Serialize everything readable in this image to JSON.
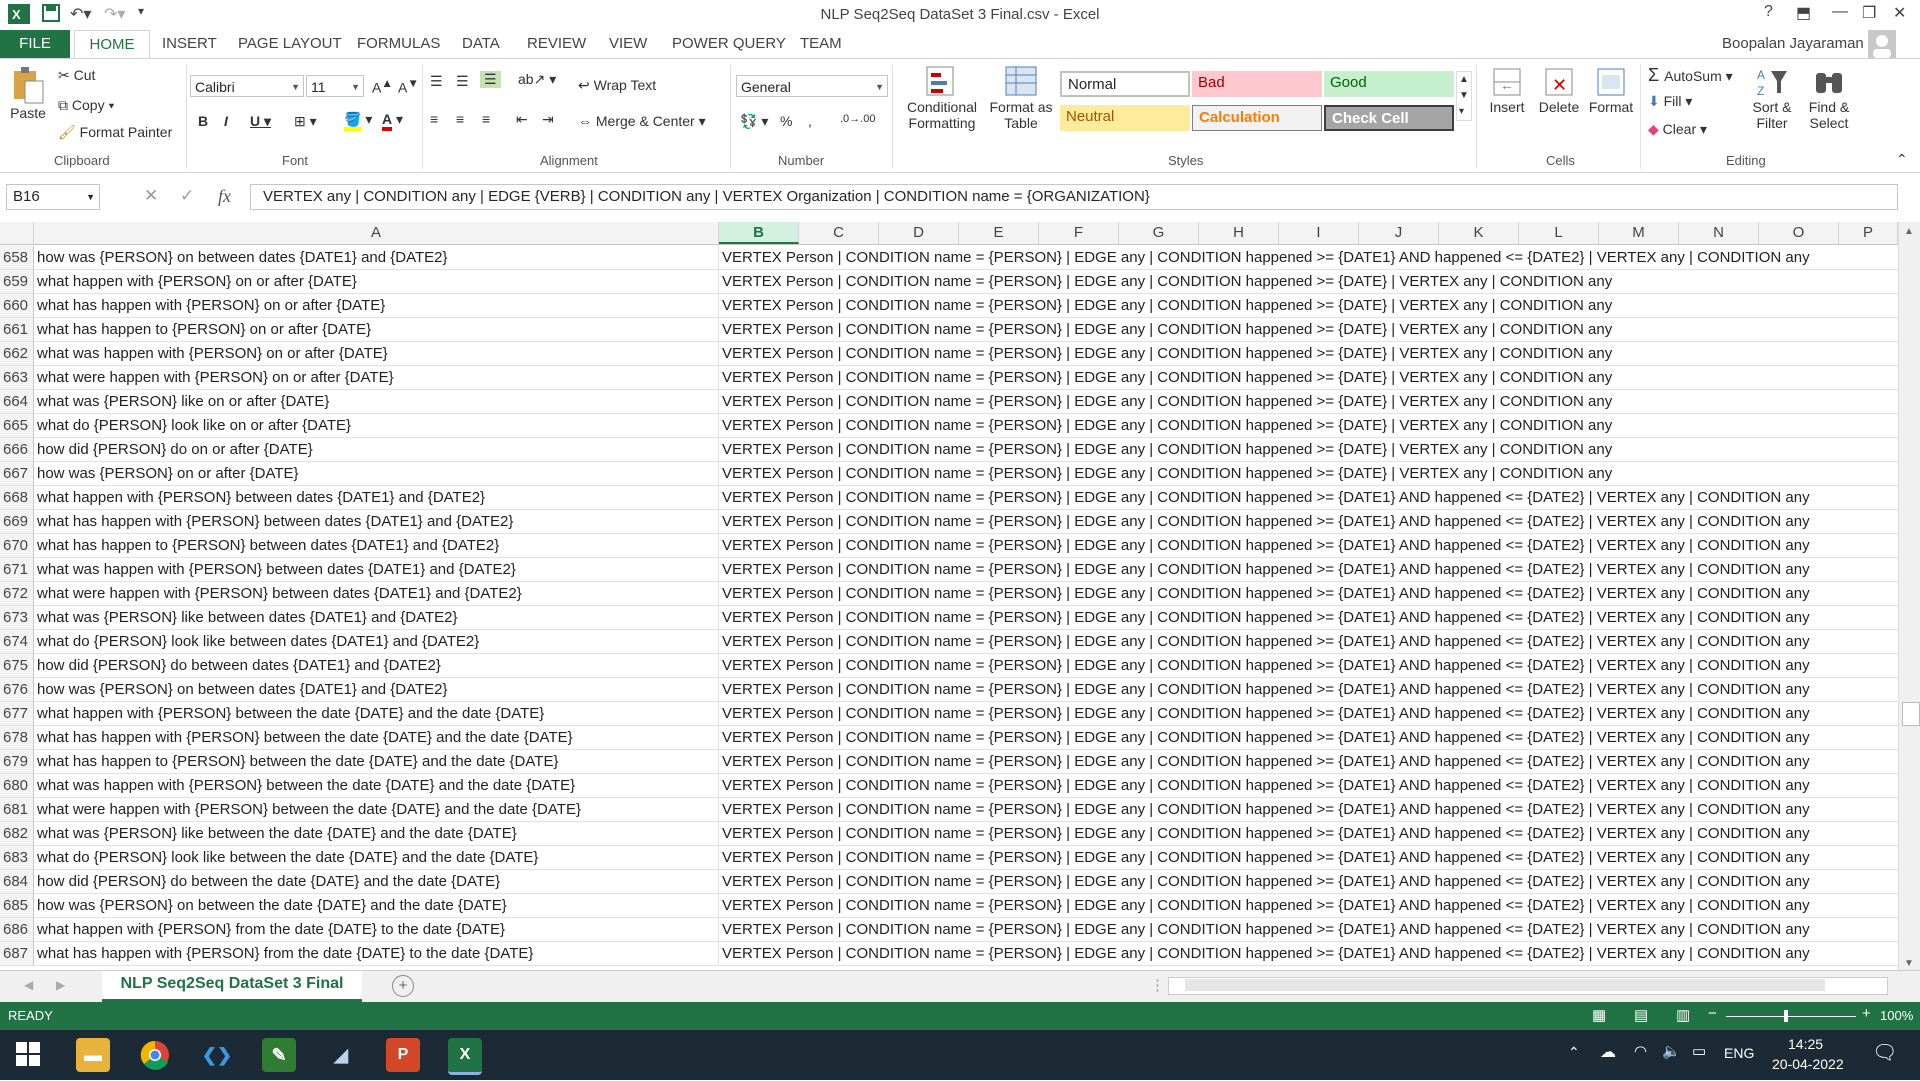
{
  "window": {
    "title": "NLP Seq2Seq DataSet 3 Final.csv - Excel",
    "user": "Boopalan Jayaraman"
  },
  "tabs": [
    "FILE",
    "HOME",
    "INSERT",
    "PAGE LAYOUT",
    "FORMULAS",
    "DATA",
    "REVIEW",
    "VIEW",
    "POWER QUERY",
    "TEAM"
  ],
  "ribbon": {
    "clipboard": {
      "label": "Clipboard",
      "paste": "Paste",
      "cut": "Cut",
      "copy": "Copy",
      "format_painter": "Format Painter"
    },
    "font": {
      "label": "Font",
      "name": "Calibri",
      "size": "11"
    },
    "alignment": {
      "label": "Alignment",
      "wrap": "Wrap Text",
      "merge": "Merge & Center"
    },
    "number": {
      "label": "Number",
      "format": "General"
    },
    "styles": {
      "label": "Styles",
      "conditional1": "Conditional",
      "conditional2": "Formatting",
      "table1": "Format as",
      "table2": "Table",
      "normal": "Normal",
      "bad": "Bad",
      "good": "Good",
      "neutral": "Neutral",
      "calculation": "Calculation",
      "check": "Check Cell"
    },
    "cells": {
      "label": "Cells",
      "insert": "Insert",
      "delete": "Delete",
      "format": "Format"
    },
    "editing": {
      "label": "Editing",
      "autosum": "AutoSum",
      "fill": "Fill",
      "clear": "Clear",
      "sort1": "Sort &",
      "sort2": "Filter",
      "find1": "Find &",
      "find2": "Select"
    }
  },
  "formula_bar": {
    "name_box": "B16",
    "fx": "fx",
    "formula": "VERTEX any | CONDITION any | EDGE {VERB} | CONDITION any | VERTEX Organization | CONDITION name = {ORGANIZATION}"
  },
  "columns": [
    "A",
    "B",
    "C",
    "D",
    "E",
    "F",
    "G",
    "H",
    "I",
    "J",
    "K",
    "L",
    "M",
    "N",
    "O",
    "P"
  ],
  "rows": [
    {
      "n": "658",
      "a": "how was {PERSON} on between dates {DATE1} and {DATE2}",
      "b": "VERTEX Person | CONDITION name = {PERSON} | EDGE any | CONDITION happened >= {DATE1} AND happened <= {DATE2} | VERTEX any | CONDITION any"
    },
    {
      "n": "659",
      "a": "what happen with {PERSON} on or after {DATE}",
      "b": "VERTEX Person | CONDITION name = {PERSON} | EDGE any | CONDITION happened >= {DATE} | VERTEX any | CONDITION any"
    },
    {
      "n": "660",
      "a": "what has happen with {PERSON} on or after {DATE}",
      "b": "VERTEX Person | CONDITION name = {PERSON} | EDGE any | CONDITION happened >= {DATE} | VERTEX any | CONDITION any"
    },
    {
      "n": "661",
      "a": "what has happen to {PERSON} on or after {DATE}",
      "b": "VERTEX Person | CONDITION name = {PERSON} | EDGE any | CONDITION happened >= {DATE} | VERTEX any | CONDITION any"
    },
    {
      "n": "662",
      "a": "what was happen with {PERSON} on or after {DATE}",
      "b": "VERTEX Person | CONDITION name = {PERSON} | EDGE any | CONDITION happened >= {DATE} | VERTEX any | CONDITION any"
    },
    {
      "n": "663",
      "a": "what were happen with {PERSON} on or after {DATE}",
      "b": "VERTEX Person | CONDITION name = {PERSON} | EDGE any | CONDITION happened >= {DATE} | VERTEX any | CONDITION any"
    },
    {
      "n": "664",
      "a": "what was {PERSON} like on or after {DATE}",
      "b": "VERTEX Person | CONDITION name = {PERSON} | EDGE any | CONDITION happened >= {DATE} | VERTEX any | CONDITION any"
    },
    {
      "n": "665",
      "a": "what do {PERSON} look like on or after {DATE}",
      "b": "VERTEX Person | CONDITION name = {PERSON} | EDGE any | CONDITION happened >= {DATE} | VERTEX any | CONDITION any"
    },
    {
      "n": "666",
      "a": "how did {PERSON} do on or after {DATE}",
      "b": "VERTEX Person | CONDITION name = {PERSON} | EDGE any | CONDITION happened >= {DATE} | VERTEX any | CONDITION any"
    },
    {
      "n": "667",
      "a": "how was {PERSON} on or after {DATE}",
      "b": "VERTEX Person | CONDITION name = {PERSON} | EDGE any | CONDITION happened >= {DATE} | VERTEX any | CONDITION any"
    },
    {
      "n": "668",
      "a": "what happen with {PERSON} between dates {DATE1} and {DATE2}",
      "b": "VERTEX Person | CONDITION name = {PERSON} | EDGE any | CONDITION happened >= {DATE1} AND happened <= {DATE2} | VERTEX any | CONDITION any"
    },
    {
      "n": "669",
      "a": "what has happen with {PERSON} between dates {DATE1} and {DATE2}",
      "b": "VERTEX Person | CONDITION name = {PERSON} | EDGE any | CONDITION happened >= {DATE1} AND happened <= {DATE2} | VERTEX any | CONDITION any"
    },
    {
      "n": "670",
      "a": "what has happen to {PERSON} between dates {DATE1} and {DATE2}",
      "b": "VERTEX Person | CONDITION name = {PERSON} | EDGE any | CONDITION happened >= {DATE1} AND happened <= {DATE2} | VERTEX any | CONDITION any"
    },
    {
      "n": "671",
      "a": "what was happen with {PERSON} between dates {DATE1} and {DATE2}",
      "b": "VERTEX Person | CONDITION name = {PERSON} | EDGE any | CONDITION happened >= {DATE1} AND happened <= {DATE2} | VERTEX any | CONDITION any"
    },
    {
      "n": "672",
      "a": "what were happen with {PERSON} between dates {DATE1} and {DATE2}",
      "b": "VERTEX Person | CONDITION name = {PERSON} | EDGE any | CONDITION happened >= {DATE1} AND happened <= {DATE2} | VERTEX any | CONDITION any"
    },
    {
      "n": "673",
      "a": "what was {PERSON} like between dates {DATE1} and {DATE2}",
      "b": "VERTEX Person | CONDITION name = {PERSON} | EDGE any | CONDITION happened >= {DATE1} AND happened <= {DATE2} | VERTEX any | CONDITION any"
    },
    {
      "n": "674",
      "a": "what do {PERSON} look like between dates {DATE1} and {DATE2}",
      "b": "VERTEX Person | CONDITION name = {PERSON} | EDGE any | CONDITION happened >= {DATE1} AND happened <= {DATE2} | VERTEX any | CONDITION any"
    },
    {
      "n": "675",
      "a": "how did {PERSON} do between dates {DATE1} and {DATE2}",
      "b": "VERTEX Person | CONDITION name = {PERSON} | EDGE any | CONDITION happened >= {DATE1} AND happened <= {DATE2} | VERTEX any | CONDITION any"
    },
    {
      "n": "676",
      "a": "how was {PERSON} on between dates {DATE1} and {DATE2}",
      "b": "VERTEX Person | CONDITION name = {PERSON} | EDGE any | CONDITION happened >= {DATE1} AND happened <= {DATE2} | VERTEX any | CONDITION any"
    },
    {
      "n": "677",
      "a": "what happen with {PERSON} between the date {DATE} and the date {DATE}",
      "b": "VERTEX Person | CONDITION name = {PERSON} | EDGE any | CONDITION happened >= {DATE1} AND happened <= {DATE2} | VERTEX any | CONDITION any"
    },
    {
      "n": "678",
      "a": "what has happen with {PERSON} between the date {DATE} and the date {DATE}",
      "b": "VERTEX Person | CONDITION name = {PERSON} | EDGE any | CONDITION happened >= {DATE1} AND happened <= {DATE2} | VERTEX any | CONDITION any"
    },
    {
      "n": "679",
      "a": "what has happen to {PERSON} between the date {DATE} and the date {DATE}",
      "b": "VERTEX Person | CONDITION name = {PERSON} | EDGE any | CONDITION happened >= {DATE1} AND happened <= {DATE2} | VERTEX any | CONDITION any"
    },
    {
      "n": "680",
      "a": "what was happen with {PERSON} between the date {DATE} and the date {DATE}",
      "b": "VERTEX Person | CONDITION name = {PERSON} | EDGE any | CONDITION happened >= {DATE1} AND happened <= {DATE2} | VERTEX any | CONDITION any"
    },
    {
      "n": "681",
      "a": "what were happen with {PERSON} between the date {DATE} and the date {DATE}",
      "b": "VERTEX Person | CONDITION name = {PERSON} | EDGE any | CONDITION happened >= {DATE1} AND happened <= {DATE2} | VERTEX any | CONDITION any"
    },
    {
      "n": "682",
      "a": "what was {PERSON} like between the date {DATE} and the date {DATE}",
      "b": "VERTEX Person | CONDITION name = {PERSON} | EDGE any | CONDITION happened >= {DATE1} AND happened <= {DATE2} | VERTEX any | CONDITION any"
    },
    {
      "n": "683",
      "a": "what do {PERSON} look like between the date {DATE} and the date {DATE}",
      "b": "VERTEX Person | CONDITION name = {PERSON} | EDGE any | CONDITION happened >= {DATE1} AND happened <= {DATE2} | VERTEX any | CONDITION any"
    },
    {
      "n": "684",
      "a": "how did {PERSON} do between the date {DATE} and the date {DATE}",
      "b": "VERTEX Person | CONDITION name = {PERSON} | EDGE any | CONDITION happened >= {DATE1} AND happened <= {DATE2} | VERTEX any | CONDITION any"
    },
    {
      "n": "685",
      "a": "how was {PERSON} on between the date {DATE} and the date {DATE}",
      "b": "VERTEX Person | CONDITION name = {PERSON} | EDGE any | CONDITION happened >= {DATE1} AND happened <= {DATE2} | VERTEX any | CONDITION any"
    },
    {
      "n": "686",
      "a": "what happen with {PERSON} from the date {DATE} to the date {DATE}",
      "b": "VERTEX Person | CONDITION name = {PERSON} | EDGE any | CONDITION happened >= {DATE1} AND happened <= {DATE2} | VERTEX any | CONDITION any"
    },
    {
      "n": "687",
      "a": "what has happen with {PERSON} from the date {DATE} to the date {DATE}",
      "b": "VERTEX Person | CONDITION name = {PERSON} | EDGE any | CONDITION happened >= {DATE1} AND happened <= {DATE2} | VERTEX any | CONDITION any"
    }
  ],
  "sheet": {
    "tab": "NLP Seq2Seq DataSet 3 Final"
  },
  "status": {
    "ready": "READY",
    "zoom": "100%"
  },
  "taskbar": {
    "lang": "ENG",
    "time": "14:25",
    "date": "20-04-2022"
  },
  "colors": {
    "excel_green": "#217346",
    "bad_bg": "#ffc7ce",
    "good_bg": "#c6efce",
    "neutral_bg": "#ffeb9c"
  }
}
